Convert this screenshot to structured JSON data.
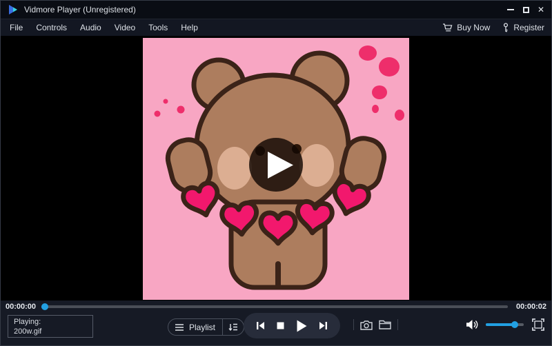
{
  "titlebar": {
    "title": "Vidmore Player (Unregistered)",
    "close_icon": "✕"
  },
  "menubar": {
    "items": [
      "File",
      "Controls",
      "Audio",
      "Video",
      "Tools",
      "Help"
    ],
    "buy_now_label": "Buy Now",
    "register_label": "Register"
  },
  "seekbar": {
    "elapsed": "00:00:00",
    "duration": "00:00:02",
    "progress_percent": 0.5
  },
  "status": {
    "playing_label": "Playing:",
    "filename": "200w.gif"
  },
  "playlist": {
    "label": "Playlist"
  },
  "volume": {
    "percent": 76
  },
  "colors": {
    "accent": "#22a0e2",
    "pink": "#f8a6c3",
    "blob": "#ee2e6b",
    "heart": "#f2186d",
    "fur": "#ad7d5e",
    "outline": "#3b2318",
    "cheek": "#dcae92"
  }
}
